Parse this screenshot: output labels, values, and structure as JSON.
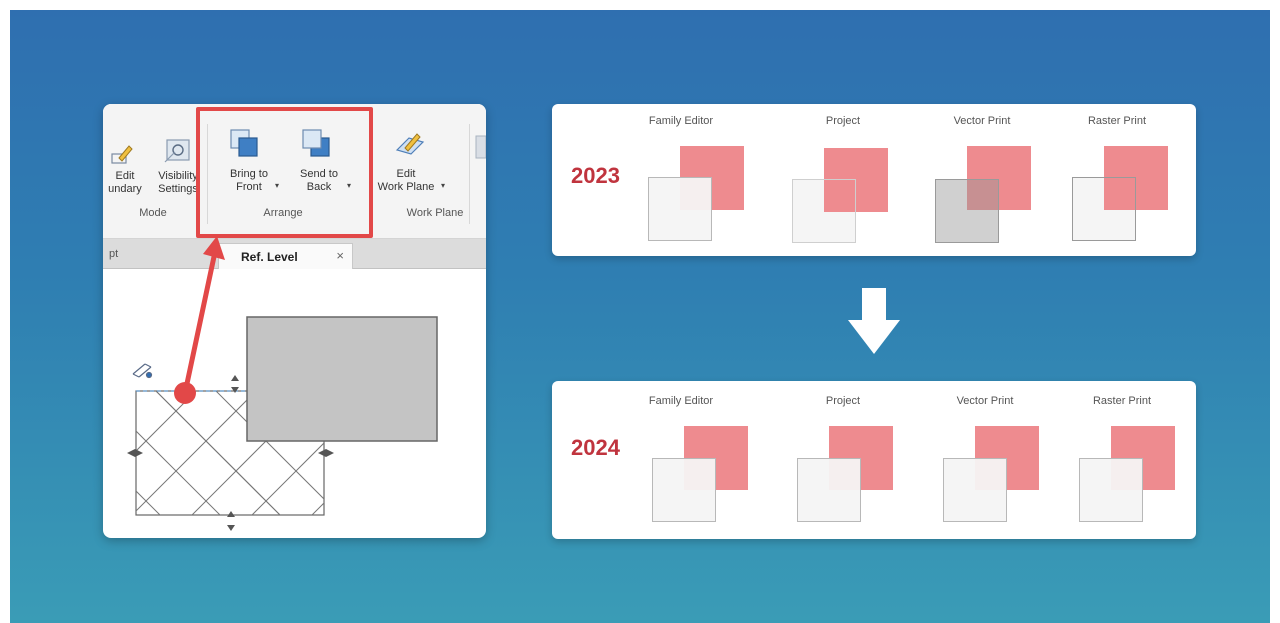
{
  "left_screenshot": {
    "ribbon": {
      "edit_boundary_label": "Edit\nundary",
      "visibility_settings_label": "Visibility\nSettings",
      "bring_to_front_label": "Bring to\nFront",
      "send_to_back_label": "Send to\nBack",
      "edit_work_plane_label": "Edit\nWork Plane",
      "group_mode": "Mode",
      "group_arrange": "Arrange",
      "group_work_plane": "Work Plane"
    },
    "tabs": {
      "prev_tab": "pt",
      "active_tab": "Ref. Level",
      "close_glyph": "×"
    }
  },
  "comparison": {
    "panels": [
      {
        "year": "2023",
        "columns": [
          "Family Editor",
          "Project",
          "Vector Print",
          "Raster Print"
        ]
      },
      {
        "year": "2024",
        "columns": [
          "Family Editor",
          "Project",
          "Vector Print",
          "Raster Print"
        ]
      }
    ]
  },
  "colors": {
    "background_top": "#2f6fb0",
    "background_bottom": "#3a9cb6",
    "highlight": "#e24848",
    "year_text": "#c0343e",
    "pink_square": "#ee8b8f",
    "gray_element": "#c4c4c4"
  },
  "icons": {
    "edit_boundary": "pencil-icon",
    "visibility_settings": "visibility-icon",
    "bring_to_front": "bring-to-front-icon",
    "send_to_back": "send-to-back-icon",
    "work_plane": "work-plane-icon",
    "transition_arrow": "down-arrow-icon"
  }
}
